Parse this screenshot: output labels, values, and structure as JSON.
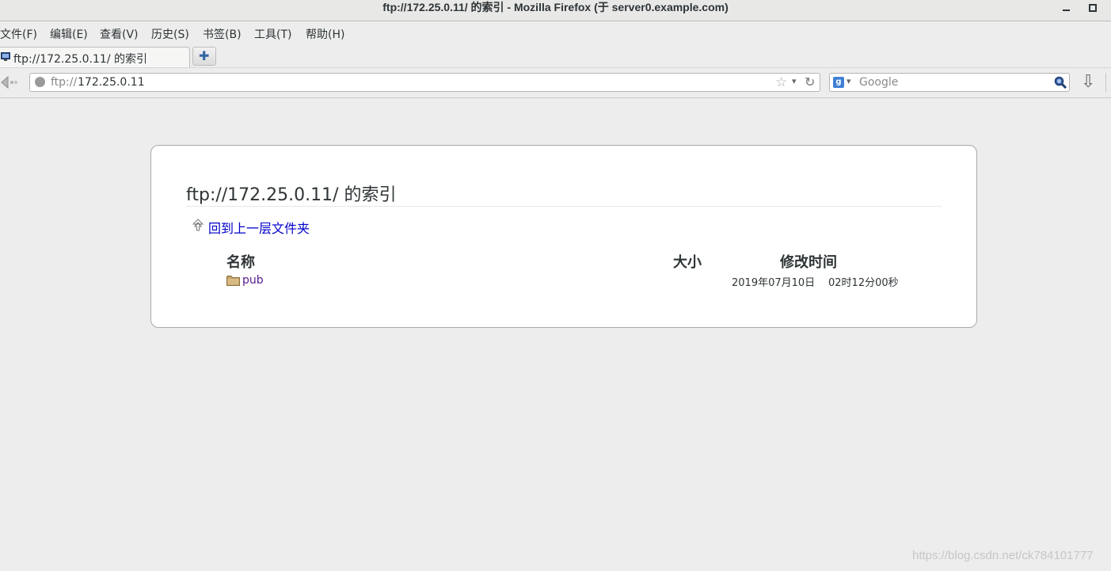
{
  "window": {
    "title": "ftp://172.25.0.11/ 的索引  -  Mozilla Firefox (于  server0.example.com)"
  },
  "menubar": {
    "items": [
      {
        "label": "文件(F)"
      },
      {
        "label": "编辑(E)"
      },
      {
        "label": "查看(V)"
      },
      {
        "label": "历史(S)"
      },
      {
        "label": "书签(B)"
      },
      {
        "label": "工具(T)"
      },
      {
        "label": "帮助(H)"
      }
    ]
  },
  "tabs": {
    "active_label": "ftp://172.25.0.11/ 的索引",
    "new_tab_icon": "plus-icon"
  },
  "navbar": {
    "url_scheme": "ftp://",
    "url_host": "172.25.0.11",
    "search_placeholder": "Google",
    "search_engine_icon": "google-icon"
  },
  "page": {
    "heading": "ftp://172.25.0.11/ 的索引",
    "up_link": "回到上一层文件夹",
    "columns": {
      "name": "名称",
      "size": "大小",
      "modified": "修改时间"
    },
    "rows": [
      {
        "name": "pub",
        "type": "folder",
        "size": "",
        "date": "2019年07月10日",
        "time": "02时12分00秒"
      }
    ]
  },
  "watermark": "https://blog.csdn.net/ck784101777",
  "colors": {
    "background": "#ededed",
    "link": "#0000cc",
    "visited_link": "#551a8b"
  }
}
